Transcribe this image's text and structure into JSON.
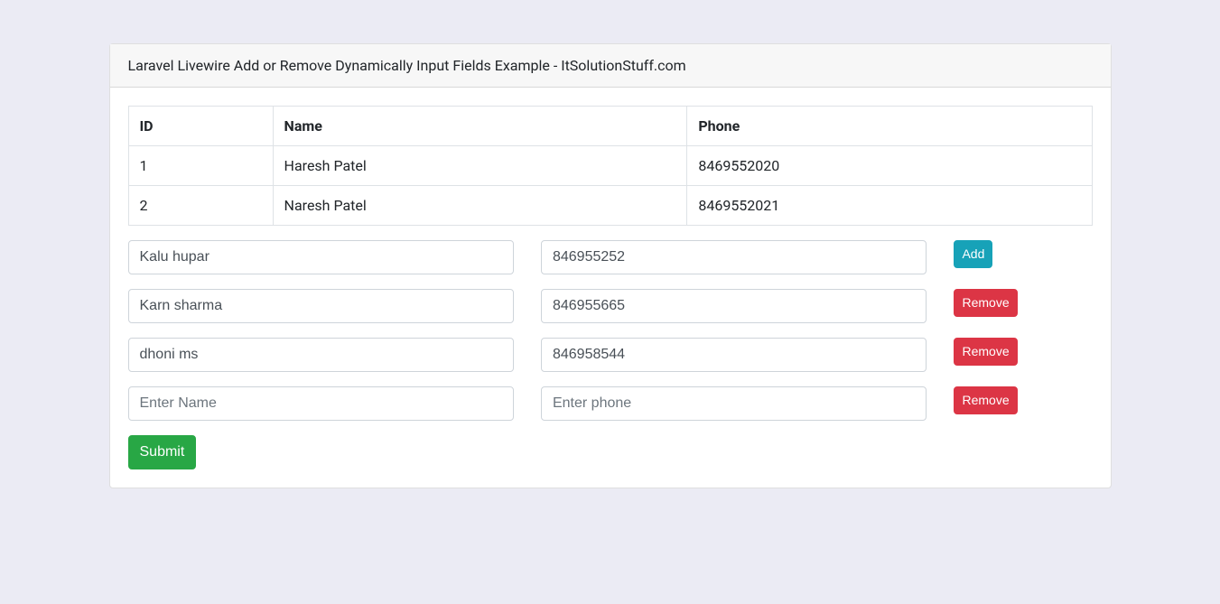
{
  "header": {
    "title": "Laravel Livewire Add or Remove Dynamically Input Fields Example - ItSolutionStuff.com"
  },
  "table": {
    "columns": {
      "id": "ID",
      "name": "Name",
      "phone": "Phone"
    },
    "rows": [
      {
        "id": "1",
        "name": "Haresh Patel",
        "phone": "8469552020"
      },
      {
        "id": "2",
        "name": "Naresh Patel",
        "phone": "8469552021"
      }
    ]
  },
  "form": {
    "name_placeholder": "Enter Name",
    "phone_placeholder": "Enter phone",
    "add_label": "Add",
    "remove_label": "Remove",
    "submit_label": "Submit",
    "rows": [
      {
        "name": "Kalu hupar",
        "phone": "846955252"
      },
      {
        "name": "Karn sharma",
        "phone": "846955665"
      },
      {
        "name": "dhoni ms",
        "phone": "846958544"
      },
      {
        "name": "",
        "phone": ""
      }
    ]
  }
}
